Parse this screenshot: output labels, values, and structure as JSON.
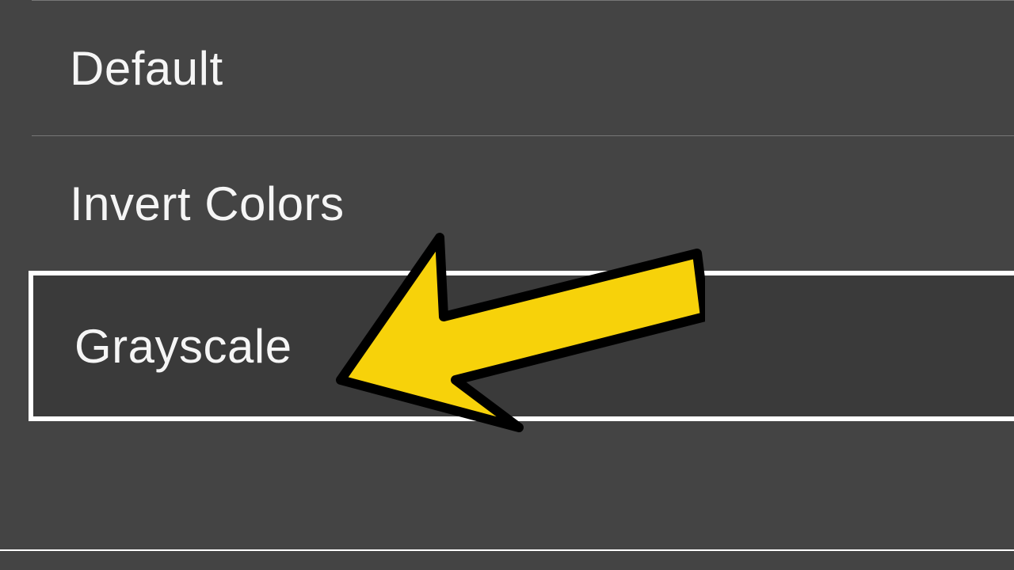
{
  "menu": {
    "items": [
      {
        "label": "Default"
      },
      {
        "label": "Invert Colors"
      },
      {
        "label": "Grayscale",
        "selected": true
      }
    ]
  },
  "annotation": {
    "arrow_color": "#f7d20a",
    "arrow_stroke": "#000000"
  }
}
